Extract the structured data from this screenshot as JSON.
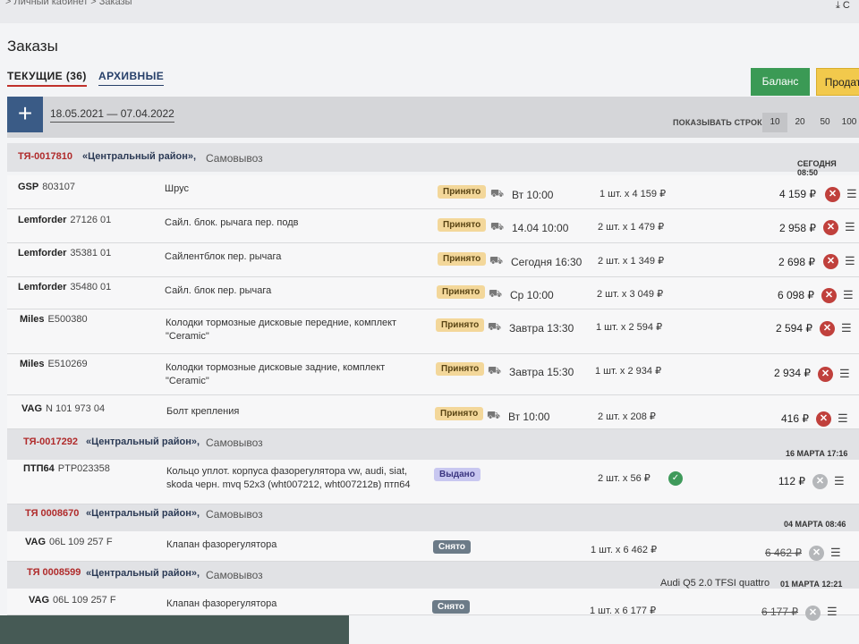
{
  "breadcrumbs": "> Личный кабинет > Заказы",
  "download_label": "С",
  "page_title": "Заказы",
  "tabs": {
    "current": "ТЕКУЩИЕ (36)",
    "archive": "АРХИВНЫЕ"
  },
  "buttons": {
    "balance": "Баланс",
    "sell": "Продат"
  },
  "filter": {
    "add_label": "+",
    "date_range": "18.05.2021 — 07.04.2022",
    "rows_label": "ПОКАЗЫВАТЬ СТРОК:",
    "rows_options": [
      "10",
      "20",
      "50",
      "100"
    ]
  },
  "colors": {
    "accent_red": "#c0312b",
    "balance_green": "#3b9a55",
    "sell_yellow": "#f2c94c",
    "plus_blue": "#3a5b86"
  },
  "orders": [
    {
      "number": "ТЯ-0017810",
      "place": "«Центральный район»,",
      "pickup": "Самовывоз",
      "date": "СЕГОДНЯ 08:50",
      "car": ""
    },
    {
      "number": "ТЯ-0017292",
      "place": "«Центральный район»,",
      "pickup": "Самовывоз",
      "date": "16 МАРТА 17:16",
      "car": ""
    },
    {
      "number": "ТЯ 0008670",
      "place": "«Центральный район»,",
      "pickup": "Самовывоз",
      "date": "04 МАРТА 08:46",
      "car": ""
    },
    {
      "number": "ТЯ 0008599",
      "place": "«Центральный район»,",
      "pickup": "Самовывоз",
      "date": "01 МАРТА 12:21",
      "car": "Audi Q5 2.0 TFSI quattro"
    }
  ],
  "items": [
    {
      "brand": "GSP",
      "article": "803107",
      "name": "Шрус",
      "status": "Принято",
      "delivery": "Вт 10:00",
      "qty": "1 шт. x 4 159 ₽",
      "price": "4 159 ₽"
    },
    {
      "brand": "Lemforder",
      "article": "27126 01",
      "name": "Сайл. блок. рычага пер. подв",
      "status": "Принято",
      "delivery": "14.04 10:00",
      "qty": "2 шт. x 1 479 ₽",
      "price": "2 958 ₽"
    },
    {
      "brand": "Lemforder",
      "article": "35381 01",
      "name": "Сайлентблок пер. рычага",
      "status": "Принято",
      "delivery": "Сегодня 16:30",
      "qty": "2 шт. x 1 349 ₽",
      "price": "2 698 ₽"
    },
    {
      "brand": "Lemforder",
      "article": "35480 01",
      "name": "Сайл. блок пер. рычага",
      "status": "Принято",
      "delivery": "Ср 10:00",
      "qty": "2 шт. x 3 049 ₽",
      "price": "6 098 ₽"
    },
    {
      "brand": "Miles",
      "article": "E500380",
      "name": "Колодки тормозные дисковые передние, комплект \"Ceramic\"",
      "status": "Принято",
      "delivery": "Завтра 13:30",
      "qty": "1 шт. x 2 594 ₽",
      "price": "2 594 ₽"
    },
    {
      "brand": "Miles",
      "article": "E510269",
      "name": "Колодки тормозные дисковые задние, комплект \"Ceramic\"",
      "status": "Принято",
      "delivery": "Завтра 15:30",
      "qty": "1 шт. x 2 934 ₽",
      "price": "2 934 ₽"
    },
    {
      "brand": "VAG",
      "article": "N 101 973 04",
      "name": "Болт крепления",
      "status": "Принято",
      "delivery": "Вт 10:00",
      "qty": "2 шт. x 208 ₽",
      "price": "416 ₽"
    },
    {
      "brand": "ПТП64",
      "article": "PTP023358",
      "name": "Кольцо уплот. корпуса фазорегулятора vw, audi, siat, skoda черн. mvq 52x3 (wht007212, wht007212в) птп64",
      "status": "Выдано",
      "delivery": "",
      "qty": "2 шт. x 56 ₽",
      "price": "112 ₽"
    },
    {
      "brand": "VAG",
      "article": "06L 109 257 F",
      "name": "Клапан фазорегулятора",
      "status": "Снято",
      "delivery": "",
      "qty": "1 шт. x 6 462 ₽",
      "price": "6 462 ₽"
    },
    {
      "brand": "VAG",
      "article": "06L 109 257 F",
      "name": "Клапан фазорегулятора",
      "status": "Снято",
      "delivery": "",
      "qty": "1 шт. x 6 177 ₽",
      "price": "6 177 ₽"
    }
  ]
}
